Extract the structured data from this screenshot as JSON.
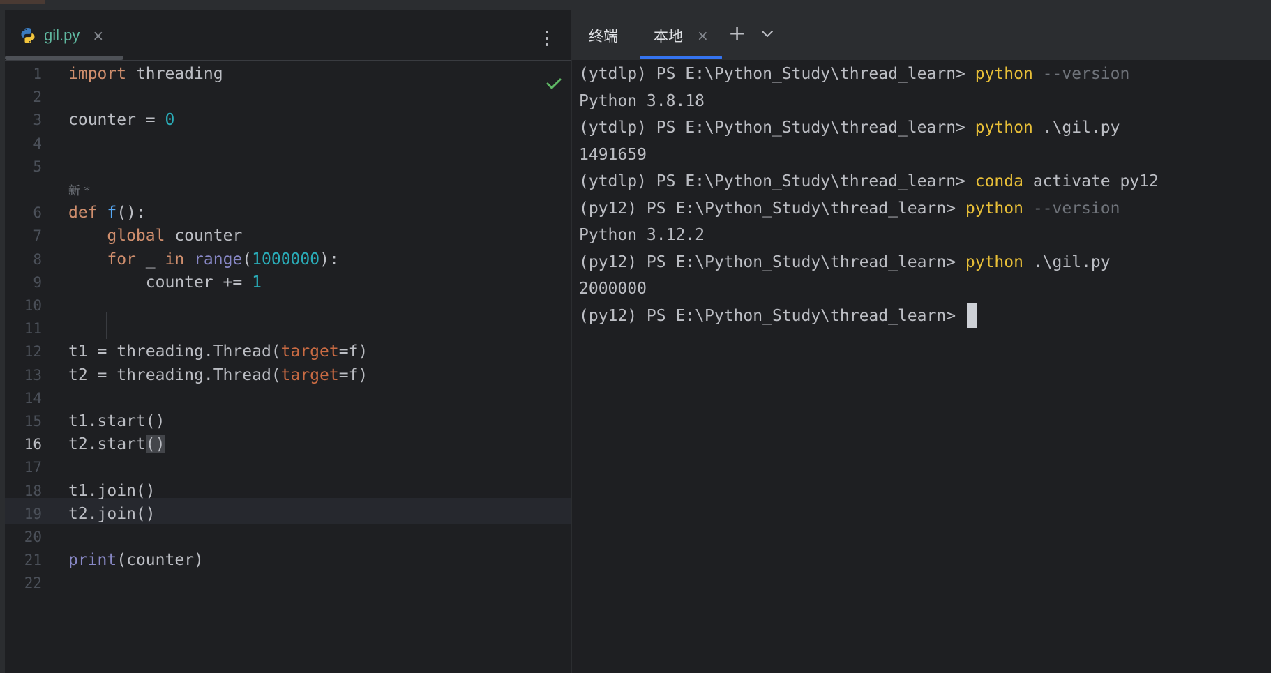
{
  "editor": {
    "tab": {
      "label": "gil.py",
      "close": "×"
    },
    "hint": "新 *",
    "lines": [
      {
        "n": "1",
        "segs": [
          [
            "kw",
            "import"
          ],
          [
            "t",
            " threading"
          ]
        ]
      },
      {
        "n": "2",
        "segs": []
      },
      {
        "n": "3",
        "segs": [
          [
            "t",
            "counter = "
          ],
          [
            "num",
            "0"
          ]
        ]
      },
      {
        "n": "4",
        "segs": []
      },
      {
        "n": "5",
        "segs": []
      },
      {
        "n": "6",
        "segs": [
          [
            "kw",
            "def"
          ],
          [
            "t",
            " "
          ],
          [
            "fn",
            "f"
          ],
          [
            "t",
            "():"
          ]
        ]
      },
      {
        "n": "7",
        "segs": [
          [
            "t",
            "    "
          ],
          [
            "kw",
            "global"
          ],
          [
            "t",
            " counter"
          ]
        ]
      },
      {
        "n": "8",
        "segs": [
          [
            "t",
            "    "
          ],
          [
            "kw",
            "for"
          ],
          [
            "t",
            " _ "
          ],
          [
            "kw",
            "in"
          ],
          [
            "t",
            " "
          ],
          [
            "bi",
            "range"
          ],
          [
            "t",
            "("
          ],
          [
            "num",
            "1000000"
          ],
          [
            "t",
            "):"
          ]
        ]
      },
      {
        "n": "9",
        "segs": [
          [
            "t",
            "        counter += "
          ],
          [
            "num",
            "1"
          ]
        ]
      },
      {
        "n": "10",
        "segs": []
      },
      {
        "n": "11",
        "segs": []
      },
      {
        "n": "12",
        "segs": [
          [
            "t",
            "t1 = threading.Thread("
          ],
          [
            "param",
            "target"
          ],
          [
            "t",
            "=f)"
          ]
        ]
      },
      {
        "n": "13",
        "segs": [
          [
            "t",
            "t2 = threading.Thread("
          ],
          [
            "param",
            "target"
          ],
          [
            "t",
            "=f)"
          ]
        ]
      },
      {
        "n": "14",
        "segs": []
      },
      {
        "n": "15",
        "segs": [
          [
            "t",
            "t1.start()"
          ]
        ]
      },
      {
        "n": "16",
        "segs": [
          [
            "t",
            "t2.start"
          ],
          [
            "hl",
            "()"
          ]
        ]
      },
      {
        "n": "17",
        "segs": []
      },
      {
        "n": "18",
        "segs": [
          [
            "t",
            "t1.join()"
          ]
        ]
      },
      {
        "n": "19",
        "segs": [
          [
            "t",
            "t2.join()"
          ]
        ]
      },
      {
        "n": "20",
        "segs": []
      },
      {
        "n": "21",
        "segs": [
          [
            "bi",
            "print"
          ],
          [
            "t",
            "(counter)"
          ]
        ]
      },
      {
        "n": "22",
        "segs": []
      }
    ]
  },
  "terminal": {
    "title": "终端",
    "tab": {
      "label": "本地",
      "close": "×"
    },
    "add": "+",
    "lines": [
      [
        [
          "t",
          "(ytdlp) PS E:\\Python_Study\\thread_learn> "
        ],
        [
          "cmd",
          "python"
        ],
        [
          "flag",
          " --version"
        ]
      ],
      [
        [
          "t",
          "Python 3.8.18"
        ]
      ],
      [
        [
          "t",
          "(ytdlp) PS E:\\Python_Study\\thread_learn> "
        ],
        [
          "cmd",
          "python"
        ],
        [
          "t",
          " .\\gil.py"
        ]
      ],
      [
        [
          "t",
          "1491659"
        ]
      ],
      [
        [
          "t",
          "(ytdlp) PS E:\\Python_Study\\thread_learn> "
        ],
        [
          "cmd",
          "conda"
        ],
        [
          "t",
          " activate py12"
        ]
      ],
      [
        [
          "t",
          "(py12) PS E:\\Python_Study\\thread_learn> "
        ],
        [
          "cmd",
          "python"
        ],
        [
          "flag",
          " --version"
        ]
      ],
      [
        [
          "t",
          "Python 3.12.2"
        ]
      ],
      [
        [
          "t",
          "(py12) PS E:\\Python_Study\\thread_learn> "
        ],
        [
          "cmd",
          "python"
        ],
        [
          "t",
          " .\\gil.py"
        ]
      ],
      [
        [
          "t",
          "2000000"
        ]
      ],
      [
        [
          "t",
          "(py12) PS E:\\Python_Study\\thread_learn> "
        ],
        [
          "cursor",
          ""
        ]
      ]
    ]
  },
  "colors": {
    "background": "#1e1f22",
    "keyword": "#cf8e6d",
    "number": "#2aacb8",
    "function": "#56a8f5",
    "builtin": "#8888c6",
    "parameter": "#ca6b43",
    "terminal_command": "#e8bf38",
    "accent": "#3574f0",
    "success": "#5fb865"
  },
  "icons": {
    "file": "python-icon",
    "menu": "more-vertical-icon",
    "status": "checkmark-icon",
    "new_tab": "plus-icon",
    "dropdown": "chevron-down-icon"
  }
}
